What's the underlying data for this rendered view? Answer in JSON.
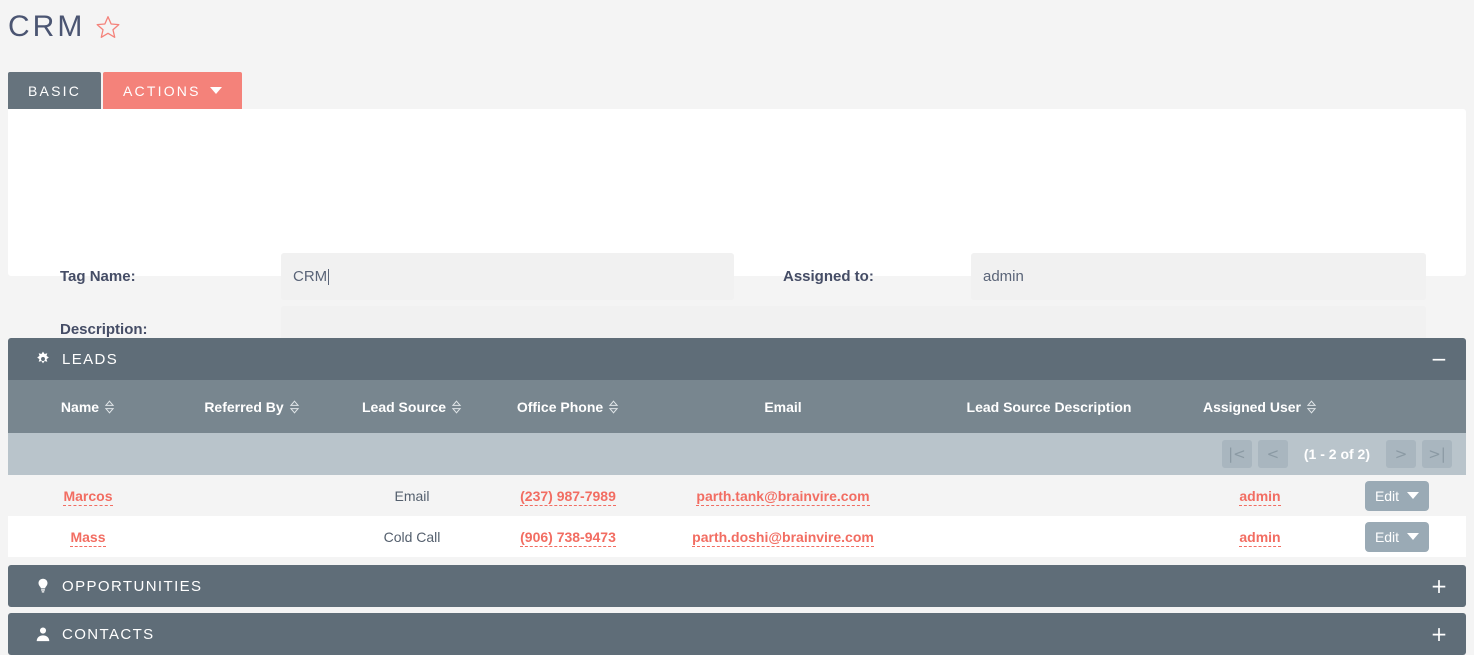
{
  "header": {
    "title": "CRM",
    "favorite_icon": "star-outline-icon",
    "tabs": [
      {
        "label": "BASIC",
        "id": "basic",
        "active": true
      },
      {
        "label": "ACTIONS",
        "id": "actions",
        "has_caret": true
      }
    ]
  },
  "basic_panel": {
    "fields": [
      {
        "label": "Tag Name:",
        "value": "CRM",
        "focused": true
      },
      {
        "label": "Assigned to:",
        "value": "admin",
        "focused": false
      },
      {
        "label": "Description:",
        "value": "",
        "focused": false
      }
    ],
    "tag_name_label": "Tag Name:",
    "tag_name_value": "CRM",
    "assigned_to_label": "Assigned to:",
    "assigned_to_value": "admin",
    "description_label": "Description:",
    "description_value": ""
  },
  "panels": [
    {
      "id": "leads",
      "title": "LEADS",
      "icon": "gear-icon",
      "expanded": true,
      "toggle": "−"
    },
    {
      "id": "opportunities",
      "title": "OPPORTUNITIES",
      "icon": "lightbulb-icon",
      "expanded": false,
      "toggle": "+"
    },
    {
      "id": "contacts",
      "title": "CONTACTS",
      "icon": "person-icon",
      "expanded": false,
      "toggle": "+"
    }
  ],
  "leads_table": {
    "columns": [
      {
        "label": "Name",
        "sortable": true
      },
      {
        "label": "Referred By",
        "sortable": true
      },
      {
        "label": "Lead Source",
        "sortable": true
      },
      {
        "label": "Office Phone",
        "sortable": true
      },
      {
        "label": "Email",
        "sortable": false
      },
      {
        "label": "Lead Source Description",
        "sortable": false
      },
      {
        "label": "Assigned User",
        "sortable": true
      },
      {
        "label": "",
        "sortable": false
      }
    ],
    "pagination": {
      "count_text": "(1 - 2 of 2)",
      "first_label": "|<",
      "prev_label": "<",
      "next_label": ">",
      "last_label": ">|"
    },
    "rows": [
      {
        "name": "Marcos",
        "referred_by": "",
        "lead_source": "Email",
        "office_phone": "(237) 987-7989",
        "email": "parth.tank@brainvire.com",
        "lead_source_description": "",
        "assigned_user": "admin",
        "action_label": "Edit"
      },
      {
        "name": "Mass",
        "referred_by": "",
        "lead_source": "Cold Call",
        "office_phone": "(906) 738-9473",
        "email": "parth.doshi@brainvire.com",
        "lead_source_description": "",
        "assigned_user": "admin",
        "action_label": "Edit"
      }
    ]
  },
  "colors": {
    "page_bg": "#f4f4f4",
    "title_text": "#4b5572",
    "accent_coral": "#f4827a",
    "link_coral": "#f26d62",
    "tab_basic_bg": "#66737d",
    "panel_bar_bg": "#5f6d78",
    "table_header_bg": "#78868f",
    "pager_bg": "#b9c4cb",
    "edit_btn_bg": "#9aaab5",
    "field_bg": "#f1f1f1"
  }
}
